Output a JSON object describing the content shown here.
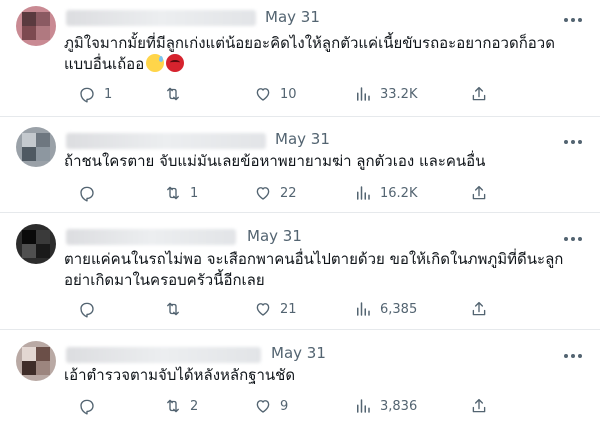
{
  "tweets": [
    {
      "date": "May 31",
      "text": "ภูมิใจมากมั้ยที่มีลูกเก่งแต่น้อยอะคิดไงให้ลูกตัวแค่เนี้ยขับรถอะอยากอวดก็อวดแบบอื่นเถ้ออ",
      "replies": "1",
      "retweets": "",
      "likes": "10",
      "views": "33.2K",
      "emoji": [
        "sweat-smile-emoji",
        "angry-face-emoji"
      ]
    },
    {
      "date": "May 31",
      "text": "ถ้าชนใครตาย จับแม่มันเลยข้อหาพยายามฆ่า ลูกตัวเอง และคนอื่น",
      "replies": "",
      "retweets": "1",
      "likes": "22",
      "views": "16.2K"
    },
    {
      "date": "May 31",
      "text": "ตายแค่คนในรถไม่พอ จะเสือกพาคนอื่นไปตายด้วย ขอให้เกิดในภพภูมิที่ดีนะลูก อย่าเกิดมาในครอบครัวนี้อีกเลย",
      "replies": "",
      "retweets": "",
      "likes": "21",
      "views": "6,385"
    },
    {
      "date": "May 31",
      "text": "เอ้าตำรวจตามจับได้หลังหลักฐานชัด",
      "replies": "",
      "retweets": "2",
      "likes": "9",
      "views": "3,836"
    }
  ],
  "colors": {
    "muted": "#536471",
    "text": "#0f1419",
    "divider": "#e6e9ec"
  },
  "icons": [
    "reply-icon",
    "retweet-icon",
    "like-icon",
    "views-icon",
    "share-icon",
    "more-icon"
  ]
}
